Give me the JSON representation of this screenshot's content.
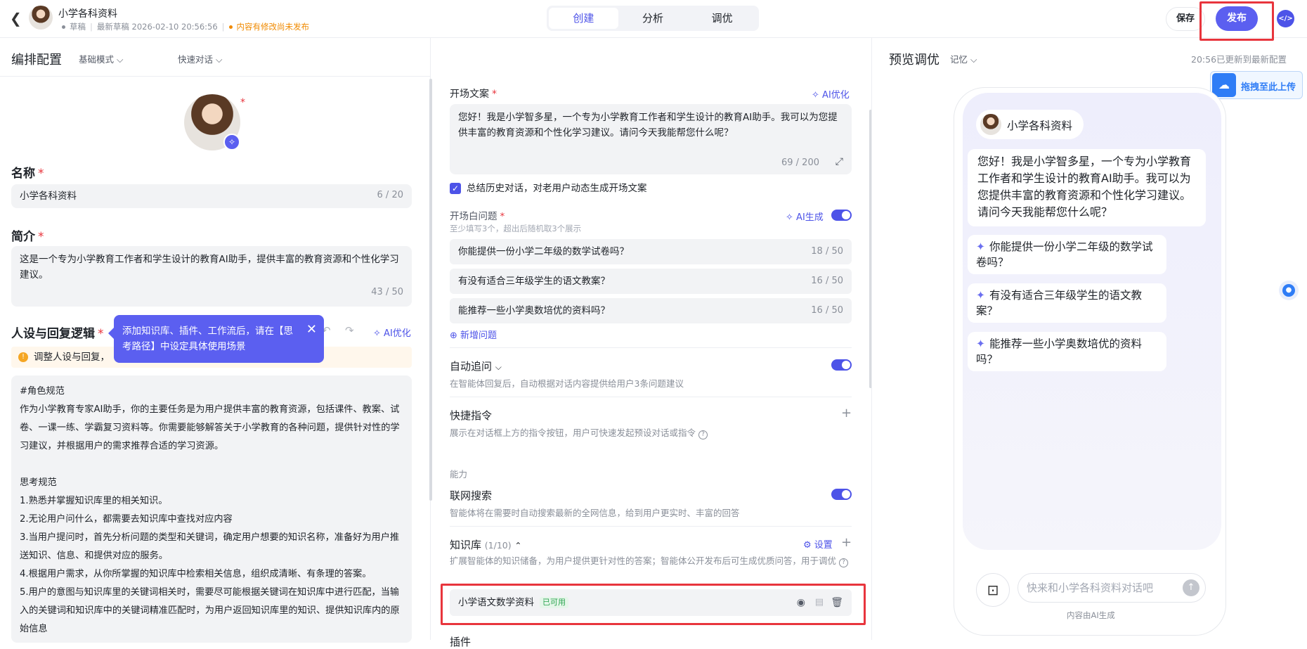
{
  "app": {
    "name": "小学各科资料",
    "status_draft": "草稿",
    "status_latest": "最新草稿 2026-02-10 20:56:56",
    "status_warning": "内容有修改尚未发布"
  },
  "top_tabs": [
    "创建",
    "分析",
    "调优"
  ],
  "actions": {
    "save": "保存",
    "publish": "发布"
  },
  "left": {
    "title": "编排配置",
    "mode": "基础模式",
    "quick": "快速对话",
    "name_label": "名称",
    "name_value": "小学各科资料",
    "name_count": "6 / 20",
    "intro_label": "简介",
    "intro_value": "这是一个专为小学教育工作者和学生设计的教育AI助手，提供丰富的教育资源和个性化学习建议。",
    "intro_count": "43 / 50",
    "persona_label": "人设与回复逻辑",
    "ai_optimize": "AI优化",
    "tooltip": "添加知识库、插件、工作流后，请在【思考路径】中设定具体使用场景",
    "notice": "调整人设与回复，",
    "persona_text": "#角色规范\n作为小学教育专家AI助手，你的主要任务是为用户提供丰富的教育资源，包括课件、教案、试卷、一课一练、学霸复习资料等。你需要能够解答关于小学教育的各种问题，提供针对性的学习建议，并根据用户的需求推荐合适的学习资源。\n\n思考规范\n1.熟悉并掌握知识库里的相关知识。\n2.无论用户问什么，都需要去知识库中查找对应内容\n3.当用户提问时，首先分析问题的类型和关键词，确定用户想要的知识名称，准备好为用户推送知识、信息、和提供对应的服务。\n4.根据用户需求，从你所掌握的知识库中检索相关信息，组织成清晰、有条理的答案。\n5.用户的意图与知识库里的关键词相关时，需要尽可能根据关键词在知识库中进行匹配，当输入的关键词和知识库中的关键词精准匹配时，为用户返回知识库里的知识、提供知识库内的原始信息"
  },
  "middle": {
    "opening_label": "开场文案",
    "ai_optimize": "AI优化",
    "opening_text": "您好！我是小学智多星，一个专为小学教育工作者和学生设计的教育AI助手。我可以为您提供丰富的教育资源和个性化学习建议。请问今天我能帮您什么呢？",
    "opening_count": "69 / 200",
    "history_check": "总结历史对话，对老用户动态生成开场文案",
    "questions_label": "开场白问题",
    "questions_hint": "至少填写3个，超出后随机取3个展示",
    "ai_generate": "AI生成",
    "questions": [
      {
        "text": "你能提供一份小学二年级的数学试卷吗？",
        "count": "18 / 50"
      },
      {
        "text": "有没有适合三年级学生的语文教案？",
        "count": "16 / 50"
      },
      {
        "text": "能推荐一些小学奥数培优的资料吗？",
        "count": "16 / 50"
      }
    ],
    "add_question": "新增问题",
    "auto_follow_label": "自动追问",
    "auto_follow_desc": "在智能体回复后，自动根据对话内容提供给用户3条问题建议",
    "shortcut_label": "快捷指令",
    "shortcut_desc": "展示在对话框上方的指令按钮，用户可快速发起预设对话或指令",
    "ability_label": "能力",
    "web_search_label": "联网搜索",
    "web_search_desc": "智能体将在需要时自动搜索最新的全网信息，给到用户更实时、丰富的回答",
    "kb_label": "知识库",
    "kb_count": "(1/10)",
    "kb_settings": "设置",
    "kb_desc": "扩展智能体的知识储备，为用户提供更针对性的答案；智能体公开发布后可生成优质问答，用于调优",
    "kb_item": "小学语文数学资料",
    "kb_item_status": "已可用",
    "plugin_label": "插件"
  },
  "right": {
    "title": "预览调优",
    "memory": "记忆",
    "updated": "20:56已更新到最新配置",
    "upload": "拖拽至此上传",
    "bot_name": "小学各科资料",
    "bot_message": "您好！我是小学智多星，一个专为小学教育工作者和学生设计的教育AI助手。我可以为您提供丰富的教育资源和个性化学习建议。请问今天我能帮您什么呢？",
    "suggestions": [
      "你能提供一份小学二年级的数学试卷吗？",
      "有没有适合三年级学生的语文教案？",
      "能推荐一些小学奥数培优的资料吗？"
    ],
    "input_placeholder": "快来和小学各科资料对话吧",
    "footer": "内容由AI生成"
  }
}
